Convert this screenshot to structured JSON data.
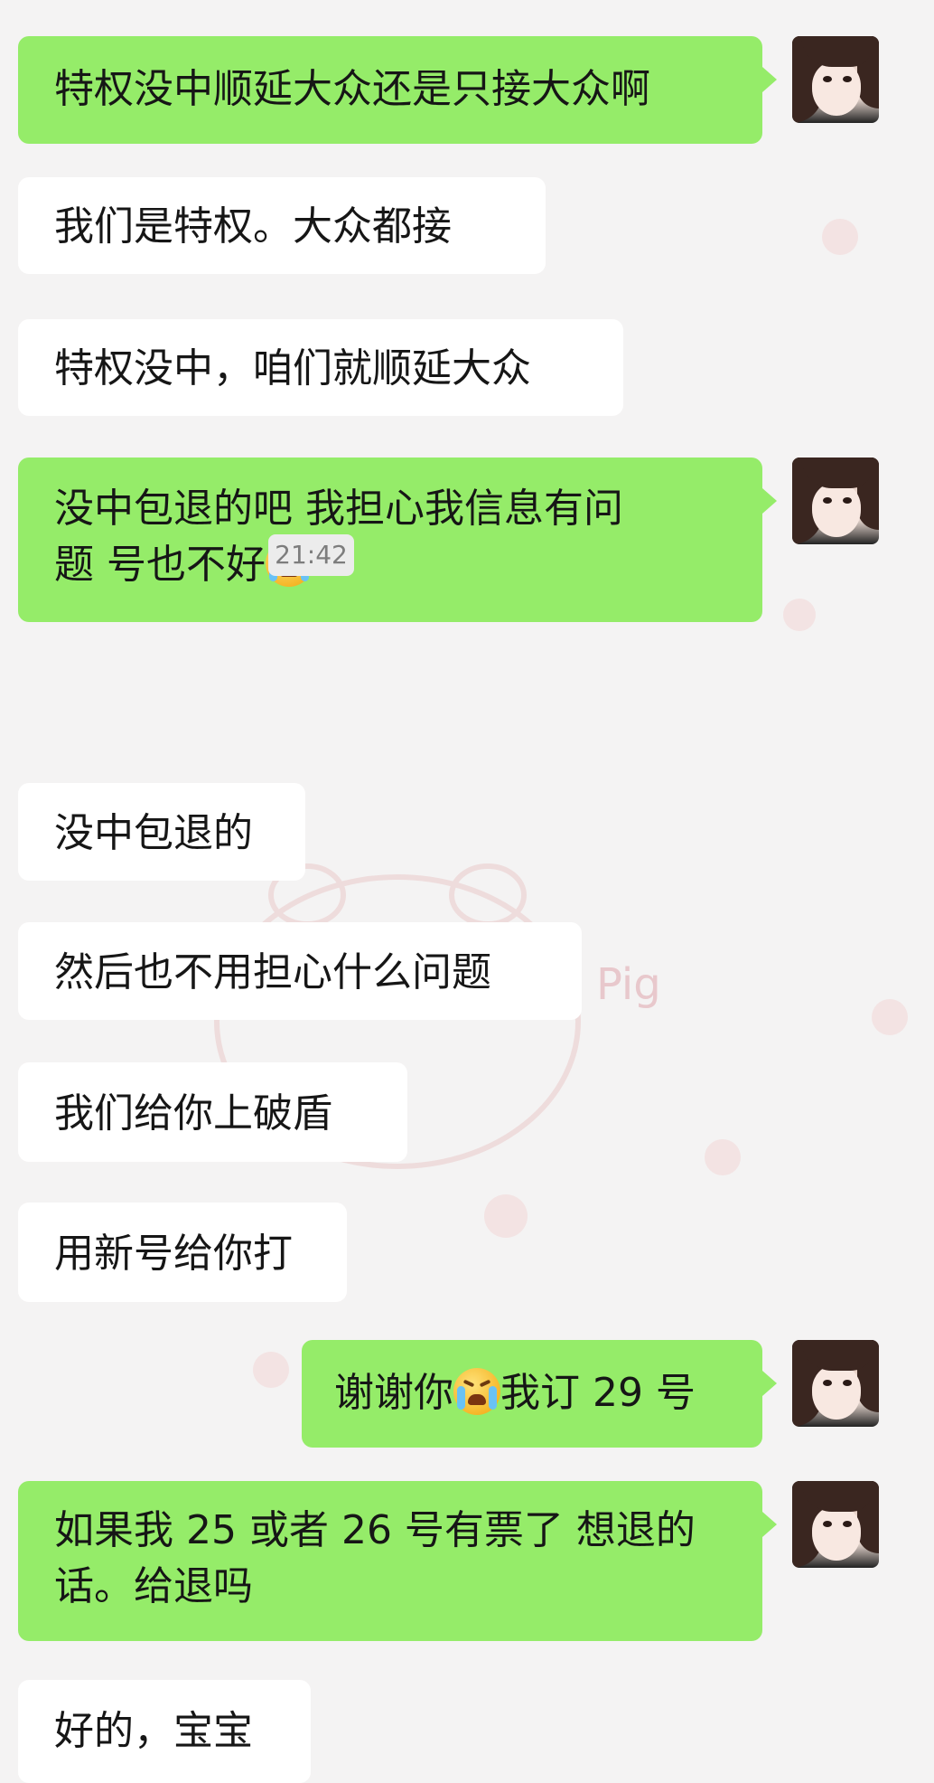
{
  "chat": {
    "messages": [
      {
        "text": "特权没中顺延大众还是只接大众啊"
      },
      {
        "text": "我们是特权。大众都接"
      },
      {
        "text": "特权没中，咱们就顺延大众"
      },
      {
        "line1": "没中包退的吧 我担心我信息有问",
        "line2": "题 号也不好"
      },
      {
        "text": "没中包退的"
      },
      {
        "text": "然后也不用担心什么问题"
      },
      {
        "text": "我们给你上破盾"
      },
      {
        "text": "用新号给你打"
      },
      {
        "before": "谢谢你",
        "after": "我订 29 号"
      },
      {
        "line1": "如果我 25 或者 26 号有票了 想退的",
        "line2": "话。给退吗"
      },
      {
        "text": "好的，宝宝"
      }
    ],
    "timestamp": "21:42"
  },
  "wallpaper": {
    "watermark_text": "Pig"
  },
  "colors": {
    "outgoing_bubble": "#95ec69",
    "incoming_bubble": "#ffffff",
    "background": "#f4f3f3",
    "timestamp_bg": "#ececec"
  },
  "icons": {
    "grimace": "persevering-face-emoji",
    "crying": "loudly-crying-face-emoji"
  }
}
